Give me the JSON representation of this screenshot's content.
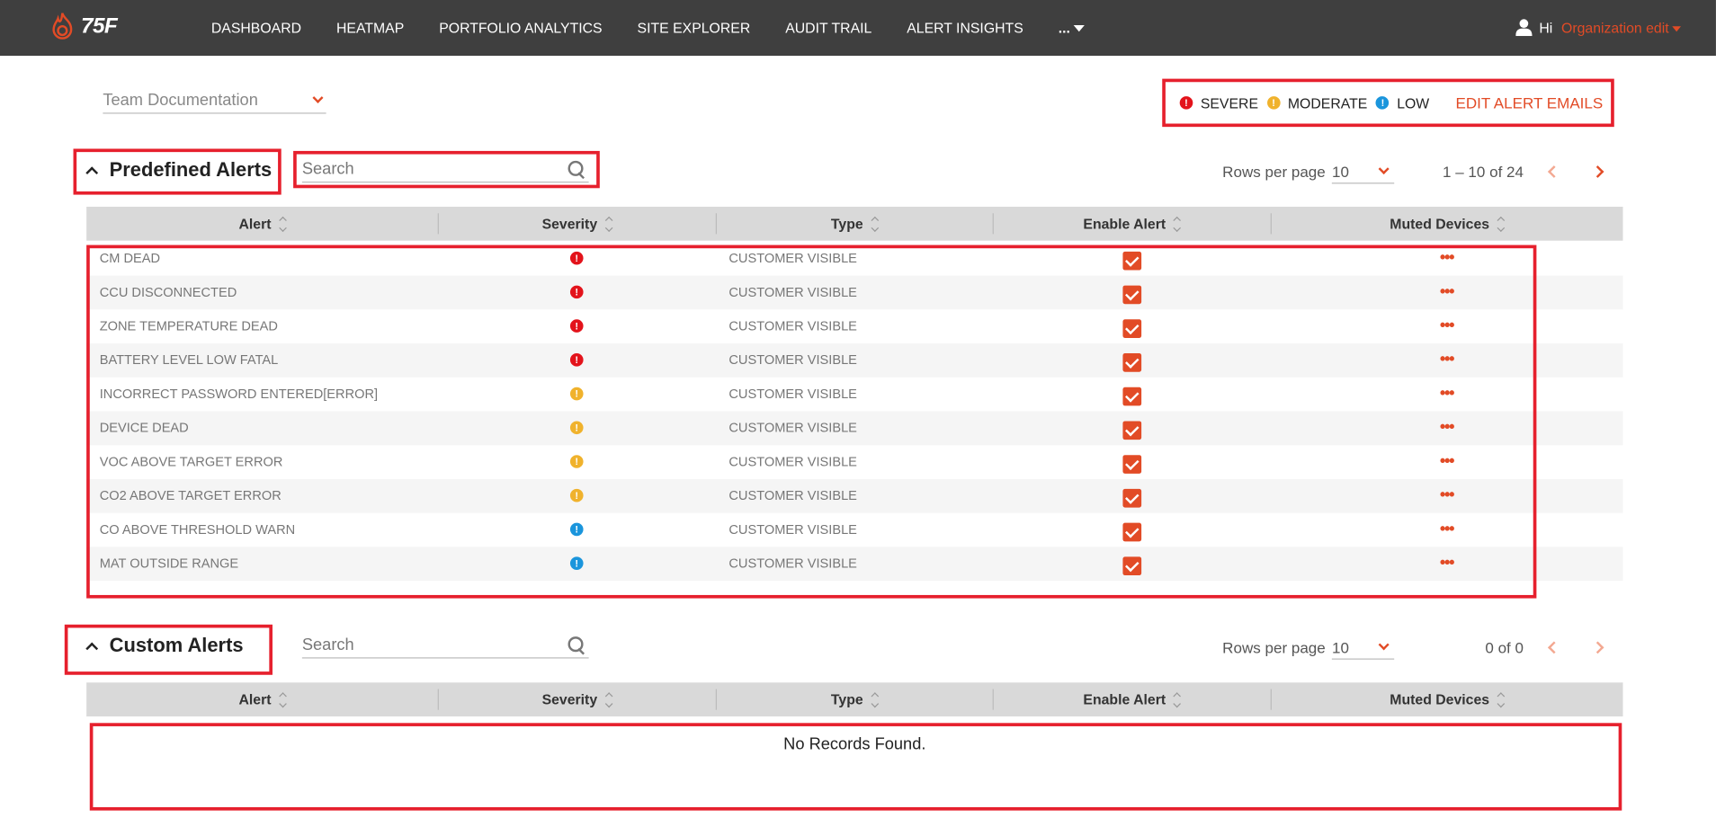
{
  "brand": {
    "name": "75F"
  },
  "nav": {
    "items": [
      "DASHBOARD",
      "HEATMAP",
      "PORTFOLIO ANALYTICS",
      "SITE EXPLORER",
      "AUDIT TRAIL",
      "ALERT INSIGHTS"
    ],
    "more_label": "..."
  },
  "user": {
    "greeting": "Hi",
    "org_label": "Organization edit"
  },
  "team_select": {
    "value": "Team Documentation"
  },
  "legend": {
    "severe": "SEVERE",
    "moderate": "MODERATE",
    "low": "LOW",
    "edit_emails": "EDIT ALERT EMAILS"
  },
  "colors": {
    "accent": "#e24b26",
    "severe": "#e3131b",
    "moderate": "#f0b22c",
    "low": "#1a95dc",
    "topbar": "#3f3f3f"
  },
  "predefined": {
    "title": "Predefined Alerts",
    "search_placeholder": "Search",
    "rows_per_page_label": "Rows per page",
    "rows_per_page": "10",
    "range": "1 – 10 of 24",
    "columns": [
      "Alert",
      "Severity",
      "Type",
      "Enable Alert",
      "Muted Devices"
    ],
    "rows": [
      {
        "alert": "CM DEAD",
        "severity": "severe",
        "type": "CUSTOMER VISIBLE",
        "enabled": true
      },
      {
        "alert": "CCU DISCONNECTED",
        "severity": "severe",
        "type": "CUSTOMER VISIBLE",
        "enabled": true
      },
      {
        "alert": "ZONE TEMPERATURE DEAD",
        "severity": "severe",
        "type": "CUSTOMER VISIBLE",
        "enabled": true
      },
      {
        "alert": "BATTERY LEVEL LOW FATAL",
        "severity": "severe",
        "type": "CUSTOMER VISIBLE",
        "enabled": true
      },
      {
        "alert": "INCORRECT PASSWORD ENTERED[ERROR]",
        "severity": "moderate",
        "type": "CUSTOMER VISIBLE",
        "enabled": true
      },
      {
        "alert": "DEVICE DEAD",
        "severity": "moderate",
        "type": "CUSTOMER VISIBLE",
        "enabled": true
      },
      {
        "alert": "VOC ABOVE TARGET ERROR",
        "severity": "moderate",
        "type": "CUSTOMER VISIBLE",
        "enabled": true
      },
      {
        "alert": "CO2 ABOVE TARGET ERROR",
        "severity": "moderate",
        "type": "CUSTOMER VISIBLE",
        "enabled": true
      },
      {
        "alert": "CO ABOVE THRESHOLD WARN",
        "severity": "low",
        "type": "CUSTOMER VISIBLE",
        "enabled": true
      },
      {
        "alert": "MAT OUTSIDE RANGE",
        "severity": "low",
        "type": "CUSTOMER VISIBLE",
        "enabled": true
      }
    ],
    "muted_icon": "more-horizontal-icon"
  },
  "custom": {
    "title": "Custom Alerts",
    "search_placeholder": "Search",
    "rows_per_page_label": "Rows per page",
    "rows_per_page": "10",
    "range": "0 of 0",
    "columns": [
      "Alert",
      "Severity",
      "Type",
      "Enable Alert",
      "Muted Devices"
    ],
    "empty_text": "No Records Found."
  }
}
